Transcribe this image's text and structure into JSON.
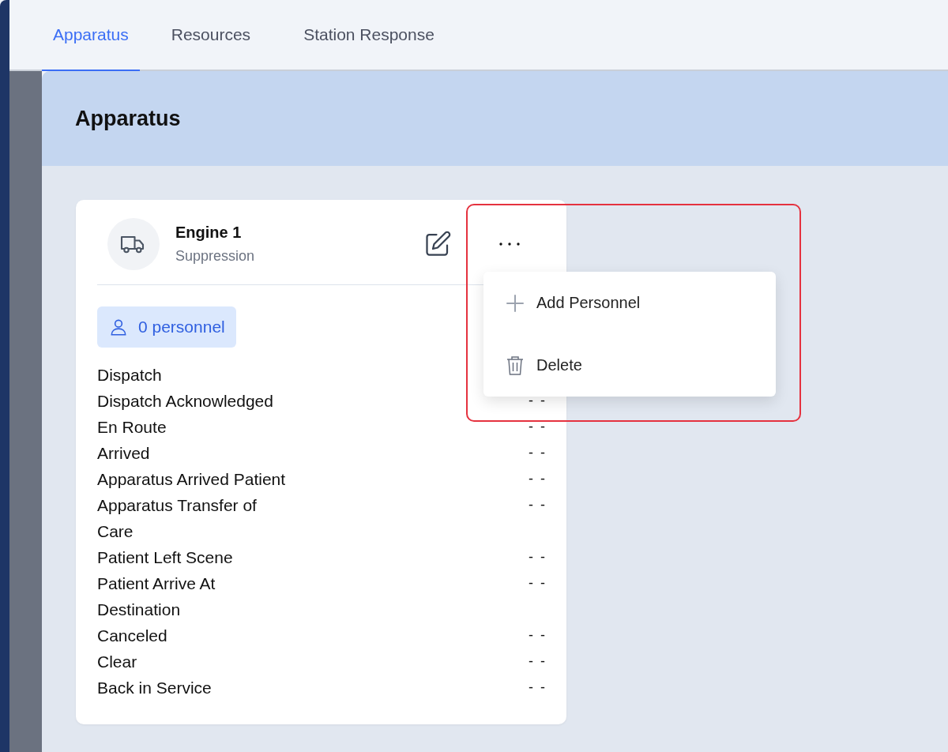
{
  "tabs": [
    {
      "label": "Apparatus",
      "selected": true
    },
    {
      "label": "Resources",
      "selected": false
    },
    {
      "label": "Station Response",
      "selected": false
    }
  ],
  "page_title": "Apparatus",
  "card": {
    "title": "Engine 1",
    "subtitle": "Suppression",
    "personnel": "0 personnel",
    "rows": [
      {
        "label": "Dispatch"
      },
      {
        "label": "Dispatch Acknowledged",
        "value": "- -"
      },
      {
        "label": "En Route",
        "value": "- -"
      },
      {
        "label": "Arrived",
        "value": "- -"
      },
      {
        "label": "Apparatus Arrived Patient",
        "value": "- -"
      },
      {
        "label": "Apparatus Transfer of Care",
        "value": "- -"
      },
      {
        "label": "Patient Left Scene",
        "value": "- -"
      },
      {
        "label": "Patient Arrive At Destination",
        "value": "- -"
      },
      {
        "label": "Canceled",
        "value": "- -"
      },
      {
        "label": "Clear",
        "value": "- -"
      },
      {
        "label": "Back in Service",
        "value": "- -"
      }
    ]
  },
  "menu": {
    "items": [
      {
        "kind": "add",
        "label": "Add Personnel"
      },
      {
        "kind": "delete",
        "label": "Delete"
      }
    ]
  }
}
